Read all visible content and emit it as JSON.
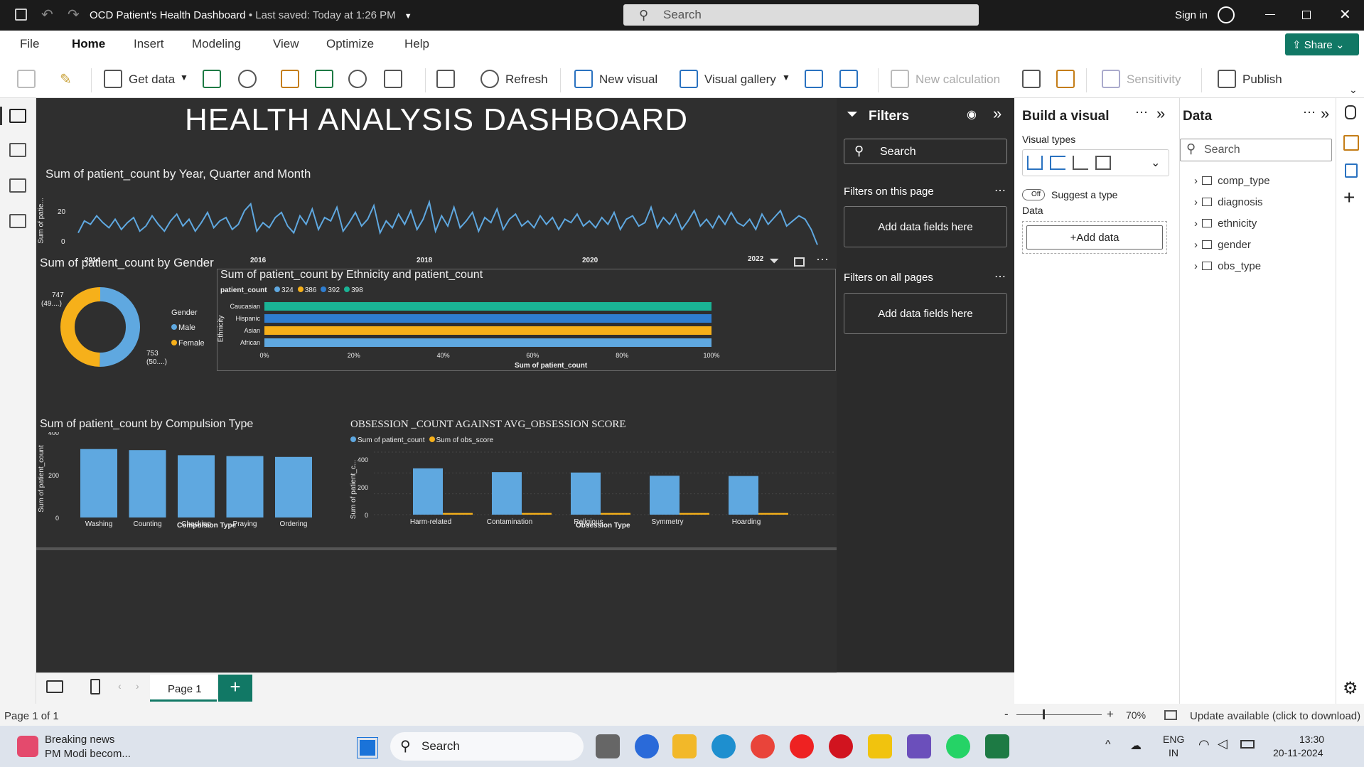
{
  "window": {
    "title": "OCD Patient's Health Dashboard",
    "saved": "• Last saved: Today at 1:26 PM",
    "search_placeholder": "Search",
    "sign_in": "Sign in"
  },
  "menu": {
    "tabs": [
      "File",
      "Home",
      "Insert",
      "Modeling",
      "View",
      "Optimize",
      "Help"
    ],
    "share": "Share"
  },
  "ribbon": {
    "get_data": "Get data",
    "refresh": "Refresh",
    "new_visual": "New visual",
    "visual_gallery": "Visual gallery",
    "new_calculation": "New calculation",
    "sensitivity": "Sensitivity",
    "publish": "Publish"
  },
  "dashboard": {
    "title": "HEALTH  ANALYSIS  DASHBOARD",
    "line": {
      "title": "Sum of patient_count by Year, Quarter and Month",
      "ylabel": "Sum of patie...",
      "yticks": [
        "20",
        "0"
      ],
      "xticks": [
        "2014",
        "2016",
        "2018",
        "2020",
        "2022"
      ]
    },
    "gender": {
      "title": "Sum of patient_count by Gender",
      "legend_title": "Gender",
      "labels": [
        "747",
        "(49....)",
        "753",
        "(50....)"
      ]
    },
    "ethnicity": {
      "title": "Sum of patient_count by Ethnicity and patient_count",
      "legend_label": "patient_count",
      "ylabel": "Ethnicity",
      "xlabel": "Sum of patient_count",
      "xticks": [
        "0%",
        "20%",
        "40%",
        "60%",
        "80%",
        "100%"
      ]
    },
    "compulsion": {
      "title": "Sum of patient_count by Compulsion Type",
      "ylabel": "Sum of patient_count",
      "xlabel": "Compulsion Type",
      "yticks": [
        "400",
        "200",
        "0"
      ]
    },
    "obsession": {
      "title": "OBSESSION _COUNT AGAINST AVG_OBSESSION SCORE",
      "ylabel": "Sum of patient_c...",
      "xlabel": "Obsession Type",
      "yticks": [
        "400",
        "200",
        "0"
      ]
    }
  },
  "chart_data": [
    {
      "type": "line",
      "title": "Sum of patient_count by Year, Quarter and Month",
      "ylabel": "Sum of patie...",
      "ylim": [
        0,
        30
      ],
      "x": [
        "2013-11",
        "2013-12",
        "2014-01",
        "2014-02",
        "2014-03",
        "2014-04",
        "2014-05",
        "2014-06",
        "2014-07",
        "2014-08",
        "2014-09",
        "2014-10",
        "2014-11",
        "2014-12",
        "2015-01",
        "2015-02",
        "2015-03",
        "2015-04",
        "2015-05",
        "2015-06",
        "2015-07",
        "2015-08",
        "2015-09",
        "2015-10",
        "2015-11",
        "2015-12",
        "2016-01",
        "2016-02",
        "2016-03",
        "2016-04",
        "2016-05",
        "2016-06",
        "2016-07",
        "2016-08",
        "2016-09",
        "2016-10",
        "2016-11",
        "2016-12",
        "2017-01",
        "2017-02",
        "2017-03",
        "2017-04",
        "2017-05",
        "2017-06",
        "2017-07",
        "2017-08",
        "2017-09",
        "2017-10",
        "2017-11",
        "2017-12",
        "2018-01",
        "2018-02",
        "2018-03",
        "2018-04",
        "2018-05",
        "2018-06",
        "2018-07",
        "2018-08",
        "2018-09",
        "2018-10",
        "2018-11",
        "2018-12",
        "2019-01",
        "2019-02",
        "2019-03",
        "2019-04",
        "2019-05",
        "2019-06",
        "2019-07",
        "2019-08",
        "2019-09",
        "2019-10",
        "2019-11",
        "2019-12",
        "2020-01",
        "2020-02",
        "2020-03",
        "2020-04",
        "2020-05",
        "2020-06",
        "2020-07",
        "2020-08",
        "2020-09",
        "2020-10",
        "2020-11",
        "2020-12",
        "2021-01",
        "2021-02",
        "2021-03",
        "2021-04",
        "2021-05",
        "2021-06",
        "2021-07",
        "2021-08",
        "2021-09",
        "2021-10",
        "2021-11",
        "2021-12",
        "2022-01",
        "2022-02",
        "2022-03",
        "2022-04",
        "2022-05",
        "2022-06",
        "2022-07",
        "2022-08",
        "2022-09",
        "2022-10",
        "2022-11",
        "2022-12",
        "2023-01",
        "2023-02",
        "2023-03",
        "2023-04",
        "2023-05",
        "2023-06",
        "2023-07",
        "2023-08",
        "2023-09",
        "2023-10",
        "2023-11",
        "2023-12",
        "2024-01"
      ],
      "values": [
        11,
        18,
        16,
        21,
        17,
        14,
        19,
        13,
        17,
        20,
        12,
        15,
        21,
        16,
        12,
        18,
        22,
        15,
        19,
        12,
        17,
        23,
        14,
        18,
        20,
        13,
        16,
        24,
        28,
        12,
        17,
        14,
        20,
        23,
        15,
        11,
        21,
        16,
        25,
        13,
        20,
        18,
        26,
        12,
        17,
        23,
        15,
        19,
        27,
        11,
        18,
        14,
        22,
        16,
        24,
        13,
        19,
        29,
        12,
        21,
        15,
        26,
        14,
        18,
        23,
        12,
        20,
        17,
        25,
        13,
        19,
        22,
        15,
        18,
        14,
        21,
        16,
        20,
        13,
        19,
        17,
        22,
        15,
        18,
        14,
        20,
        16,
        23,
        13,
        19,
        21,
        15,
        17,
        26,
        14,
        20,
        16,
        22,
        13,
        18,
        24,
        15,
        19,
        14,
        21,
        16,
        23,
        17,
        15,
        19,
        13,
        22,
        16,
        20,
        24,
        15,
        18,
        21,
        19,
        13,
        4
      ]
    },
    {
      "type": "pie",
      "title": "Sum of patient_count by Gender",
      "categories": [
        "Male",
        "Female"
      ],
      "values": [
        753,
        747
      ],
      "colors": [
        "#5fa8e0",
        "#f6b01a"
      ]
    },
    {
      "type": "bar",
      "title": "Sum of patient_count by Ethnicity and patient_count",
      "orientation": "horizontal-100pct-stacked",
      "legend_title": "patient_count",
      "categories": [
        "Caucasian",
        "Hispanic",
        "Asian",
        "African"
      ],
      "series": [
        {
          "name": "324",
          "color": "#5fa8e0",
          "values": [
            0,
            0,
            0,
            100
          ]
        },
        {
          "name": "386",
          "color": "#f6b01a",
          "values": [
            0,
            0,
            100,
            0
          ]
        },
        {
          "name": "392",
          "color": "#2f7ed0",
          "values": [
            0,
            100,
            0,
            0
          ]
        },
        {
          "name": "398",
          "color": "#1ab395",
          "values": [
            100,
            0,
            0,
            0
          ]
        }
      ],
      "xlabel": "Sum of patient_count",
      "ylabel": "Ethnicity",
      "xlim": [
        0,
        100
      ]
    },
    {
      "type": "bar",
      "title": "Sum of patient_count by Compulsion Type",
      "categories": [
        "Washing",
        "Counting",
        "Checking",
        "Praying",
        "Ordering"
      ],
      "values": [
        321,
        316,
        292,
        288,
        284
      ],
      "xlabel": "Compulsion Type",
      "ylabel": "Sum of patient_count",
      "ylim": [
        0,
        400
      ],
      "color": "#5fa8e0"
    },
    {
      "type": "bar",
      "title": "OBSESSION _COUNT AGAINST AVG_OBSESSION SCORE",
      "categories": [
        "Harm-related",
        "Contamination",
        "Religious",
        "Symmetry",
        "Hoarding"
      ],
      "series": [
        {
          "name": "Sum of patient_count",
          "color": "#5fa8e0",
          "values": [
            333,
            306,
            303,
            280,
            278
          ]
        },
        {
          "name": "Sum of obs_score",
          "color": "#f6b01a",
          "values": [
            12,
            12,
            12,
            12,
            12
          ]
        }
      ],
      "xlabel": "Obsession Type",
      "ylabel": "Sum of patient_c...",
      "ylim": [
        0,
        450
      ]
    }
  ],
  "filters": {
    "title": "Filters",
    "search": "Search",
    "this_page": "Filters on this page",
    "all_pages": "Filters on all pages",
    "add_fields": "Add data fields here"
  },
  "build": {
    "title": "Build a visual",
    "visual_types": "Visual types",
    "toggle": "Off",
    "suggest": "Suggest a type",
    "data": "Data",
    "add_data": "+Add data"
  },
  "data_pane": {
    "title": "Data",
    "search": "Search",
    "tables": [
      "comp_type",
      "diagnosis",
      "ethnicity",
      "gender",
      "obs_type"
    ]
  },
  "pages": {
    "tab": "Page 1",
    "add": "+",
    "status": "Page 1 of 1",
    "zoom": "70%",
    "update": "Update available (click to download)"
  },
  "taskbar": {
    "news_title": "Breaking news",
    "news_sub": "PM Modi becom...",
    "search": "Search",
    "lang1": "ENG",
    "lang2": "IN",
    "time": "13:30",
    "date": "20-11-2024"
  }
}
